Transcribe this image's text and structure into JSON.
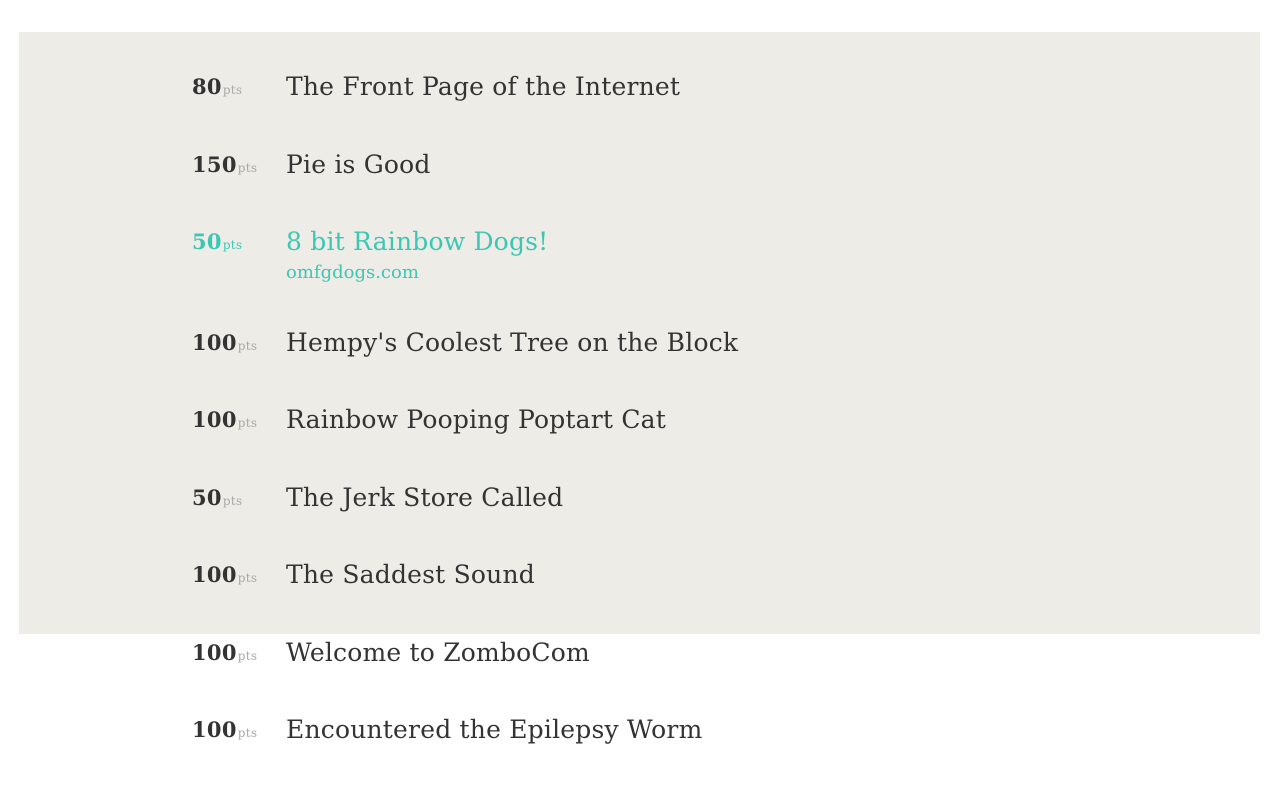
{
  "theme": {
    "panel_background": "#edece6",
    "text_color": "#333333",
    "accent_color": "#3cc7b4",
    "unit_color": "#a8a8a8"
  },
  "posts": [
    {
      "points": "80",
      "unit": "pts",
      "title": "The Front Page of the Internet",
      "domain": "",
      "active": false
    },
    {
      "points": "150",
      "unit": "pts",
      "title": "Pie is Good",
      "domain": "",
      "active": false
    },
    {
      "points": "50",
      "unit": "pts",
      "title": "8 bit Rainbow Dogs!",
      "domain": "omfgdogs.com",
      "active": true
    },
    {
      "points": "100",
      "unit": "pts",
      "title": "Hempy's Coolest Tree on the Block",
      "domain": "",
      "active": false
    },
    {
      "points": "100",
      "unit": "pts",
      "title": "Rainbow Pooping Poptart Cat",
      "domain": "",
      "active": false
    },
    {
      "points": "50",
      "unit": "pts",
      "title": "The Jerk Store Called",
      "domain": "",
      "active": false
    },
    {
      "points": "100",
      "unit": "pts",
      "title": "The Saddest Sound",
      "domain": "",
      "active": false
    },
    {
      "points": "100",
      "unit": "pts",
      "title": "Welcome to ZomboCom",
      "domain": "",
      "active": false
    },
    {
      "points": "100",
      "unit": "pts",
      "title": "Encountered the Epilepsy Worm",
      "domain": "",
      "active": false
    }
  ]
}
